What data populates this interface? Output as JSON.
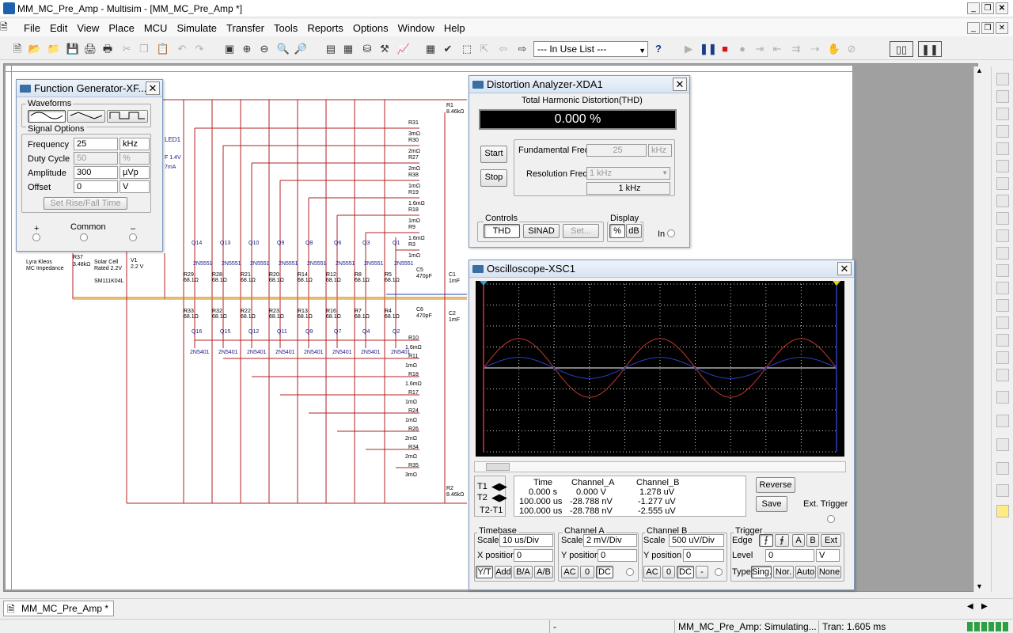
{
  "window": {
    "title": "MM_MC_Pre_Amp - Multisim - [MM_MC_Pre_Amp *]"
  },
  "menu": [
    "File",
    "Edit",
    "View",
    "Place",
    "MCU",
    "Simulate",
    "Transfer",
    "Tools",
    "Reports",
    "Options",
    "Window",
    "Help"
  ],
  "toolbar": {
    "in_use_list": "--- In Use List ---"
  },
  "function_generator": {
    "title": "Function Generator-XF...",
    "waveforms_label": "Waveforms",
    "signal_options_label": "Signal Options",
    "frequency": {
      "label": "Frequency",
      "value": "25",
      "unit": "kHz"
    },
    "duty_cycle": {
      "label": "Duty Cycle",
      "value": "50",
      "unit": "%"
    },
    "amplitude": {
      "label": "Amplitude",
      "value": "300",
      "unit": "µVp"
    },
    "offset": {
      "label": "Offset",
      "value": "0",
      "unit": "V"
    },
    "rise_fall_button": "Set Rise/Fall Time",
    "plus": "+",
    "common": "Common",
    "minus": "–"
  },
  "distortion_analyzer": {
    "title": "Distortion Analyzer-XDA1",
    "heading": "Total Harmonic Distortion(THD)",
    "reading": "0.000 %",
    "start": "Start",
    "stop": "Stop",
    "fundamental_label": "Fundamental Freq.",
    "fundamental_value": "25",
    "fundamental_unit": "kHz",
    "resolution_label": "Resolution Freq.",
    "resolution_value": "1 kHz",
    "resolution_display": "1 kHz",
    "controls_label": "Controls",
    "thd": "THD",
    "sinad": "SINAD",
    "set": "Set...",
    "display_label": "Display",
    "percent": "%",
    "db": "dB",
    "in_label": "In"
  },
  "oscilloscope": {
    "title": "Oscilloscope-XSC1",
    "colors": {
      "channel_a": "#c0392b",
      "channel_b": "#2a3fbf",
      "screen": "#000000"
    },
    "wave_a_amp_div": 1.4,
    "wave_b_amp_div": 0.5,
    "cycles": 2.5,
    "t1": "T1",
    "t2": "T2",
    "t2t1": "T2-T1",
    "readout": {
      "headers": [
        "Time",
        "Channel_A",
        "Channel_B"
      ],
      "rows": [
        [
          "0.000 s",
          "0.000 V",
          "1.278 uV"
        ],
        [
          "100.000 us",
          "-28.788 nV",
          "-1.277 uV"
        ],
        [
          "100.000 us",
          "-28.788 nV",
          "-2.555 uV"
        ]
      ]
    },
    "reverse": "Reverse",
    "save": "Save",
    "ext_trigger": "Ext. Trigger",
    "timebase": {
      "label": "Timebase",
      "scale_label": "Scale",
      "scale": "10 us/Div",
      "xpos_label": "X position",
      "xpos": "0",
      "buttons": [
        "Y/T",
        "Add",
        "B/A",
        "A/B"
      ]
    },
    "channel_a": {
      "label": "Channel A",
      "scale_label": "Scale",
      "scale": "2 mV/Div",
      "ypos_label": "Y position",
      "ypos": "0",
      "buttons": [
        "AC",
        "0",
        "DC"
      ]
    },
    "channel_b": {
      "label": "Channel B",
      "scale_label": "Scale",
      "scale": "500 uV/Div",
      "ypos_label": "Y position",
      "ypos": "0",
      "buttons": [
        "AC",
        "0",
        "DC",
        "-"
      ]
    },
    "trigger": {
      "label": "Trigger",
      "edge_label": "Edge",
      "edge_buttons": [
        "A",
        "B",
        "Ext"
      ],
      "level_label": "Level",
      "level": "0",
      "level_unit": "V",
      "type_label": "Type",
      "type_buttons": [
        "Sing.",
        "Nor.",
        "Auto",
        "None"
      ]
    }
  },
  "schematic": {
    "led": "LED1",
    "vf": "F 1.4V",
    "if": "7mA",
    "r37": "R37",
    "r37v": "3.48kΩ",
    "lyra": "Lyra Kleos",
    "mc": "MC Impedance",
    "solar": "Solar Cell",
    "rated": "Rated 2.2V",
    "v1": "V1",
    "v1v": "2.2 V",
    "sm": "SM111K04L",
    "top_q": [
      "Q14",
      "Q13",
      "Q10",
      "Q9",
      "Q8",
      "Q6",
      "Q3",
      "Q1"
    ],
    "bot_q": [
      "Q16",
      "Q15",
      "Q12",
      "Q11",
      "Q9",
      "Q7",
      "Q4",
      "Q2"
    ],
    "npn": "2N5551",
    "pnp": "2N5401",
    "top_r": [
      "R29",
      "R28",
      "R21",
      "R20",
      "R14",
      "R12",
      "R8",
      "R5"
    ],
    "bot_r": [
      "R33",
      "R32",
      "R22",
      "R23",
      "R13",
      "R16",
      "R7",
      "R4"
    ],
    "r_val": "68.1Ω",
    "right_r_top": [
      [
        "R31",
        "3mΩ"
      ],
      [
        "R30",
        "2mΩ"
      ],
      [
        "R27",
        "2mΩ"
      ],
      [
        "R38",
        "1mΩ"
      ],
      [
        "R19",
        "1.6mΩ"
      ],
      [
        "R18",
        "1mΩ"
      ],
      [
        "R9",
        "1.6mΩ"
      ],
      [
        "R3",
        "1mΩ"
      ]
    ],
    "right_r_bot": [
      [
        "R10",
        "1.6mΩ"
      ],
      [
        "R11",
        "1mΩ"
      ],
      [
        "R18",
        "1.6mΩ"
      ],
      [
        "R17",
        "1mΩ"
      ],
      [
        "R24",
        "1mΩ"
      ],
      [
        "R26",
        "2mΩ"
      ],
      [
        "R34",
        "2mΩ"
      ],
      [
        "R35",
        "3mΩ"
      ]
    ],
    "r1": "R1",
    "r1v": "8.46kΩ",
    "r2": "R2",
    "r2v": "8.46kΩ",
    "c5": "C5",
    "c5v": "470pF",
    "c6": "C6",
    "c6v": "470pF",
    "c1": "C1",
    "c1v": "1mF",
    "c2": "C2",
    "c2v": "1mF"
  },
  "tab": {
    "label": "MM_MC_Pre_Amp *"
  },
  "status": {
    "dash": "-",
    "sim": "MM_MC_Pre_Amp: Simulating...",
    "tran": "Tran: 1.605 ms"
  }
}
